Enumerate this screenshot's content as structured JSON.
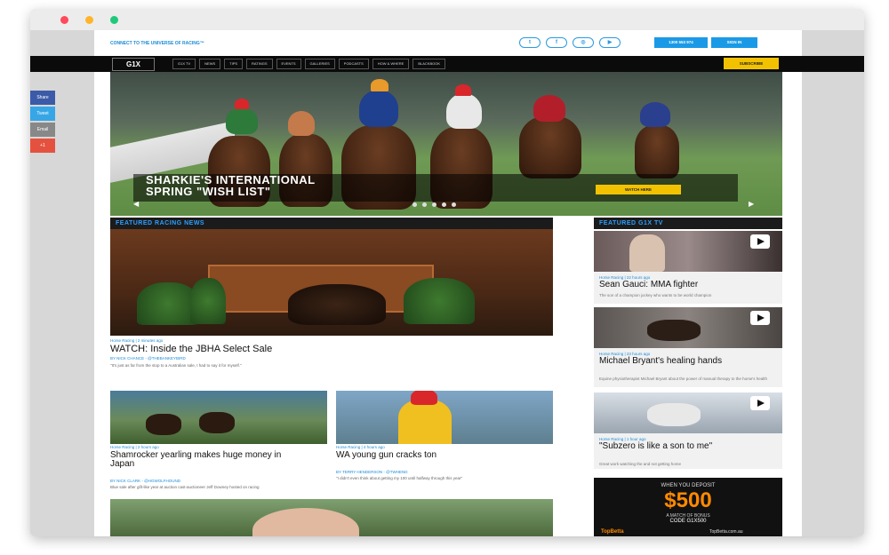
{
  "topbar": {
    "tagline": "CONNECT TO THE UNIVERSE OF RACING™",
    "phone_label": "1300 553 974",
    "signin_label": "SIGN IN",
    "social_icons": [
      "twitter-icon",
      "facebook-icon",
      "instagram-icon",
      "youtube-icon"
    ]
  },
  "nav": {
    "logo": "G1X",
    "items": [
      "G1X TV",
      "NEWS",
      "TIPS",
      "RATINGS",
      "EVENTS",
      "GALLERIES",
      "PODCASTS",
      "HOW & WHERE",
      "BLACKBOOK"
    ],
    "subscribe_label": "SUBSCRIBE"
  },
  "share": {
    "labels": [
      "Share",
      "Tweet",
      "Email",
      "+1"
    ]
  },
  "hero": {
    "title_line1": "SHARKIE'S INTERNATIONAL",
    "title_line2": "SPRING \"WISH LIST\"",
    "cta": "WATCH HERE",
    "prev": "◀",
    "next": "▶"
  },
  "featured_news": {
    "heading": "FEATURED RACING NEWS",
    "main": {
      "meta": "Horse Racing | 2 minutes ago",
      "title": "WATCH: Inside the JBHA Select Sale",
      "byline": "BY NICK CHANCE - @THEBANKEYBIRD",
      "excerpt": "\"It's just as far from the stop to a Australian sale, I had to say it for myself.\""
    },
    "left": {
      "meta": "Horse Racing | 2 hours ago",
      "title": "Shamrocker yearling makes huge money in Japan",
      "byline": "BY NICK CLARK - @HGWOLFHOUND",
      "excerpt": "Blue sale after gift-like year at auction cast-auctioneer Jeff Downey hosted on racing"
    },
    "right": {
      "meta": "Horse Racing | 4 hours ago",
      "title": "WA young gun cracks ton",
      "byline": "BY TERRY HENDERSON - @TWHEND",
      "excerpt": "\"I didn't even think about getting my 100 until halfway through this year\""
    }
  },
  "featured_tv": {
    "heading": "FEATURED G1X TV",
    "items": [
      {
        "meta": "Horse Racing | 22 hours ago",
        "title": "Sean Gauci: MMA fighter",
        "excerpt": "The son of a champion jockey who wants to be world champion"
      },
      {
        "meta": "Horse Racing | 23 hours ago",
        "title": "Michael Bryant's healing hands",
        "excerpt": "Equine physiotherapist Michael Bryant about the power of manual therapy to the horse's health"
      },
      {
        "meta": "Horse Racing | 1 hour ago",
        "title": "\"Subzero is like a son to me\"",
        "excerpt": "Great work watching the and not getting home"
      }
    ]
  },
  "ad": {
    "line1": "WHEN YOU DEPOSIT",
    "amount": "$500",
    "line2": "A MATCH OF BONUS",
    "code": "CODE G1X500",
    "brand": "TopBetta",
    "url": "TopBetta.com.au"
  }
}
